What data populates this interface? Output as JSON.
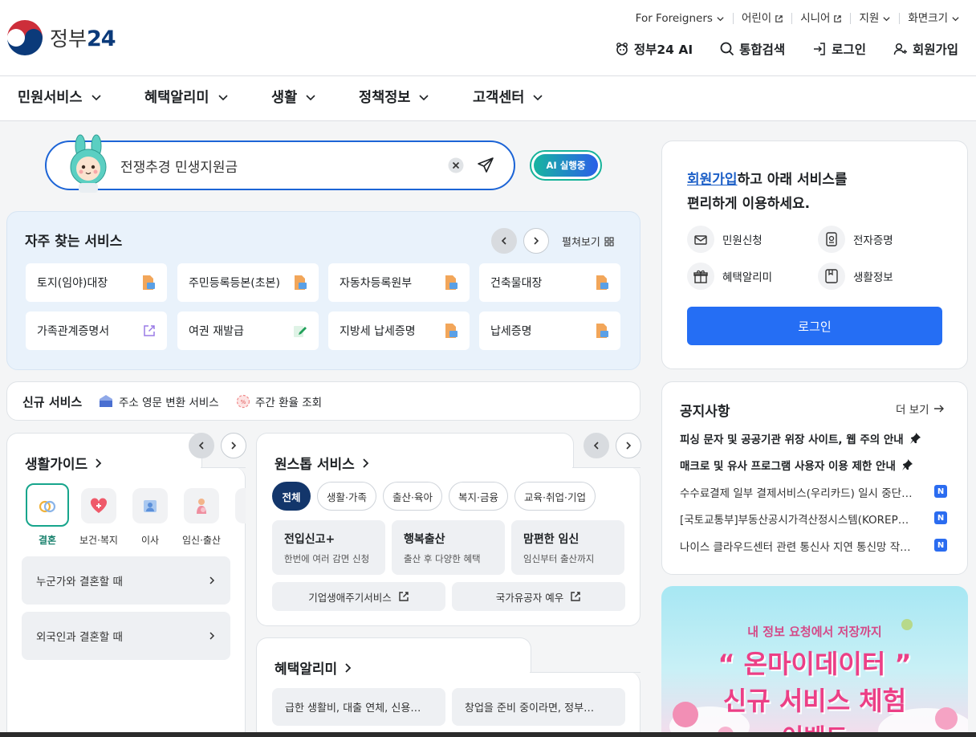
{
  "logo": {
    "text_a": "정부",
    "text_b": "24"
  },
  "utility": [
    {
      "label": "For Foreigners",
      "icon": "chevron-down-icon"
    },
    {
      "label": "어린이",
      "icon": "external-link-icon"
    },
    {
      "label": "시니어",
      "icon": "external-link-icon"
    },
    {
      "label": "지원",
      "icon": "chevron-down-icon"
    },
    {
      "label": "화면크기",
      "icon": "chevron-down-icon"
    }
  ],
  "main_links": [
    {
      "label": "정부24 AI",
      "icon": "ai-icon"
    },
    {
      "label": "통합검색",
      "icon": "search-icon"
    },
    {
      "label": "로그인",
      "icon": "login-icon"
    },
    {
      "label": "회원가입",
      "icon": "user-plus-icon"
    }
  ],
  "gnb": [
    "민원서비스",
    "혜택알리미",
    "생활",
    "정책정보",
    "고객센터"
  ],
  "search": {
    "value": "전쟁추경 민생지원금",
    "ai_button": "AI 실행중"
  },
  "frequent": {
    "title": "자주 찾는 서비스",
    "expand": "펼쳐보기",
    "items": [
      "토지(임야)대장",
      "주민등록등본(초본)",
      "자동차등록원부",
      "건축물대장",
      "가족관계증명서",
      "여권 재발급",
      "지방세 납세증명",
      "납세증명"
    ]
  },
  "new_services": {
    "title": "신규 서비스",
    "items": [
      "주소 영문 변환 서비스",
      "주간 환율 조회"
    ]
  },
  "life_guide": {
    "title": "생활가이드",
    "categories": [
      "결혼",
      "보건·복지",
      "이사",
      "임신·출산"
    ],
    "links": [
      "누군가와 결혼할 때",
      "외국인과 결혼할 때"
    ]
  },
  "onestop": {
    "title": "원스톱 서비스",
    "chips": [
      "전체",
      "생활·가족",
      "출산·육아",
      "복지·금융",
      "교육·취업·기업"
    ],
    "boxes": [
      {
        "title": "전입신고+",
        "desc": "한번에 여러 감면 신청"
      },
      {
        "title": "행복출산",
        "desc": "출산 후 다양한 혜택"
      },
      {
        "title": "맘편한 임신",
        "desc": "임신부터 출산까지"
      }
    ],
    "links": [
      "기업생애주기서비스",
      "국가유공자 예우"
    ]
  },
  "benefit": {
    "title": "혜택알리미",
    "items": [
      "급한 생활비, 대출 연체, 신용…",
      "창업을 준비 중이라면, 정부…"
    ]
  },
  "login_panel": {
    "line1_link": "회원가입",
    "line1_rest": "하고 아래 서비스를",
    "line2": "편리하게 이용하세요.",
    "features": [
      "민원신청",
      "전자증명",
      "혜택알리미",
      "생활정보"
    ],
    "button": "로그인"
  },
  "notice": {
    "title": "공지사항",
    "more": "더 보기",
    "pinned": [
      "피싱 문자 및 공공기관 위장 사이트, 웹 주의 안내",
      "매크로 및 유사 프로그램 사용자 이용 제한 안내"
    ],
    "items": [
      "수수료결제 일부 결제서비스(우리카드) 일시 중단…",
      "[국토교통부]부동산공시가격산정시스템(KOREP…",
      "나이스 클라우드센터 관련 통신사 지연 통신망 작…"
    ],
    "badge": "N"
  },
  "banner": {
    "line1": "내 정보 요청에서 저장까지",
    "line2": "“ 온마이데이터 ”",
    "line3": "신규 서비스 체험",
    "line4": "이벤트"
  }
}
